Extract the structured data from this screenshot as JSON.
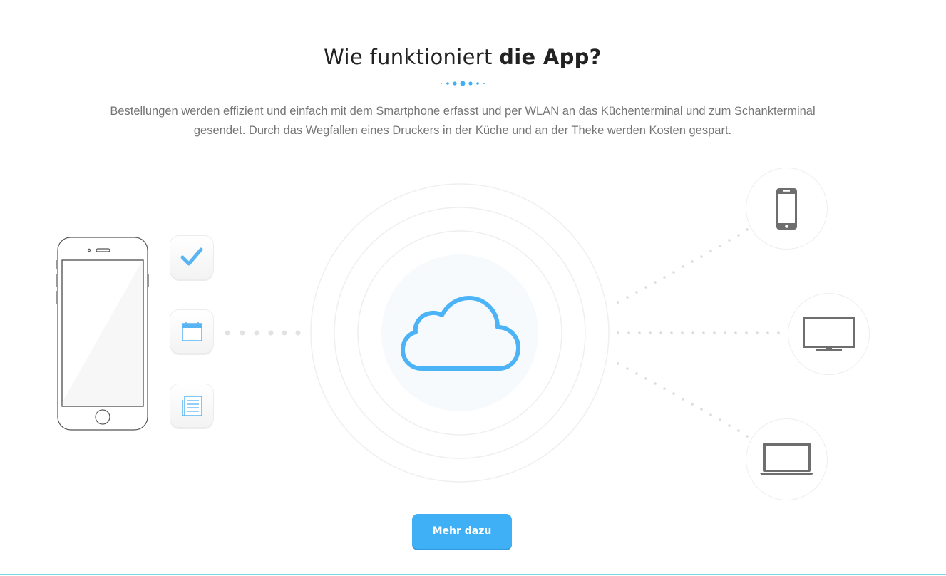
{
  "header": {
    "title_light": "Wie funktioniert ",
    "title_bold": "die App?"
  },
  "description": {
    "line1": "Bestellungen werden effizient und einfach mit dem Smartphone erfasst und per WLAN an das Küchenterminal und zum Schankterminal",
    "line2": "gesendet. Durch das Wegfallen eines Druckers in der Küche und an der Theke werden Kosten gespart."
  },
  "diagram": {
    "left_device": "smartphone-outline-icon",
    "app_icons": [
      "checkmark-icon",
      "calendar-icon",
      "list-document-icon"
    ],
    "center": "cloud-icon",
    "right_devices": [
      "smartphone-icon",
      "monitor-icon",
      "laptop-icon"
    ]
  },
  "cta": {
    "label": "Mehr dazu"
  },
  "colors": {
    "accent": "#3fb0f6",
    "title": "#222222",
    "text": "#757575",
    "device_gray": "#6e6e6e",
    "dots": "#dddddd",
    "bottom_line": "#7dd6df"
  }
}
